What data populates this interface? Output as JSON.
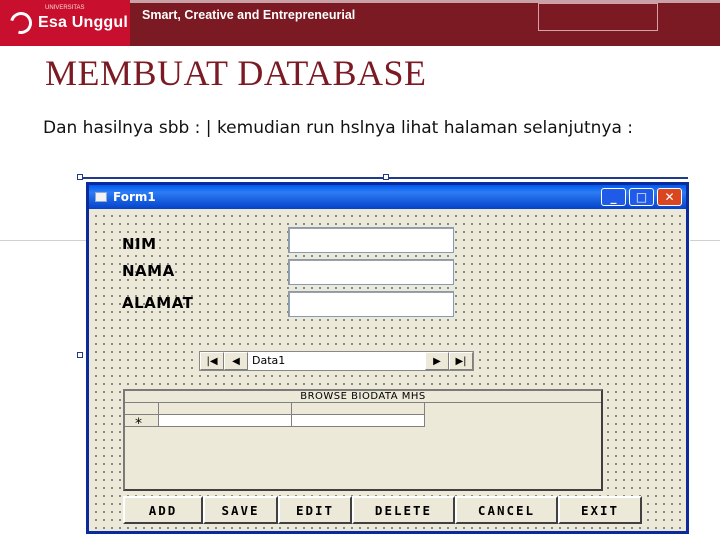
{
  "header": {
    "logo_small": "UNIVERSITAS",
    "logo_text": "Esa Unggul",
    "tagline": "Smart, Creative and Entrepreneurial"
  },
  "slide": {
    "title": "MEMBUAT  DATABASE",
    "body": "Dan hasilnya sbb : | kemudian run hslnya lihat halaman selanjutnya :"
  },
  "form": {
    "title": "Form1",
    "window_buttons": {
      "minimize": "_",
      "maximize": "□",
      "close": "✕"
    },
    "labels": {
      "nim": "NIM",
      "nama": "NAMA",
      "alamat": "ALAMAT"
    },
    "fields": {
      "nim": "",
      "nama": "",
      "alamat": ""
    },
    "data_control": {
      "caption": "Data1",
      "first": "|◀",
      "prev": "◀",
      "next": "▶",
      "last": "▶|"
    },
    "grid": {
      "caption": "BROWSE BIODATA MHS",
      "new_row_marker": "*"
    },
    "buttons": [
      "ADD",
      "SAVE",
      "EDIT",
      "DELETE",
      "CANCEL",
      "EXIT"
    ]
  },
  "colors": {
    "banner": "#7b1a22",
    "logo": "#c8102e",
    "title_text": "#7b1a22",
    "titlebar": "#0058ee",
    "form_background": "#ece9d8"
  }
}
